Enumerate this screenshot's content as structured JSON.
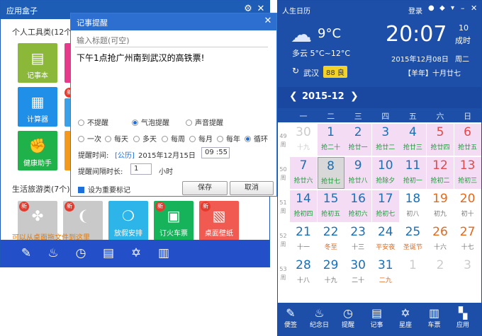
{
  "app_box": {
    "title": "应用盒子",
    "section_tools": "个人工具类(12个",
    "section_life": "生活旅游类(7个)",
    "drag_hint": "可以从桌面拖文件到这里",
    "new_badge": "新",
    "tiles": [
      {
        "label": "记事本",
        "color": "#8cb83a",
        "icon": "▤"
      },
      {
        "label": "计算器",
        "color": "#1f8fe8",
        "icon": "▦"
      },
      {
        "label": "健康助手",
        "color": "#1fb24a",
        "icon": "✊"
      }
    ],
    "life_tiles": [
      {
        "label": "",
        "color": "#c9c9c9",
        "icon": "✤"
      },
      {
        "label": "",
        "color": "#c9c9c9",
        "icon": "❨"
      },
      {
        "label": "放假安排",
        "color": "#2db4e8",
        "icon": "❍"
      },
      {
        "label": "订火车票",
        "color": "#16b35a",
        "icon": "▣"
      },
      {
        "label": "桌面壁纸",
        "color": "#f05a50",
        "icon": "▧"
      }
    ],
    "bottom_icons": [
      "pencil-icon",
      "birthday-cake-icon",
      "alarm-clock-icon",
      "notepad-icon",
      "star-of-david-icon",
      "train-icon"
    ],
    "bottom_glyphs": [
      "✎",
      "♨",
      "◷",
      "▤",
      "✡",
      "▥"
    ],
    "controls": {
      "settings": "⚙",
      "close": "✕"
    }
  },
  "dialog": {
    "title": "记事提醒",
    "close": "✕",
    "title_placeholder": "输入标题(可空)",
    "body": "下午1点抢广州南到武汉的高铁票!",
    "notify_options": [
      "不提醒",
      "气泡提醒",
      "声音提醒"
    ],
    "notify_selected": 1,
    "repeat_options": [
      "一次",
      "每天",
      "多天",
      "每周",
      "每月",
      "每年",
      "循环"
    ],
    "repeat_selected": 6,
    "remind_time_label": "提醒时间:",
    "calendar_type": "[公历]",
    "date": "2015年12月15日",
    "time": "09 :55",
    "interval_label": "提醒间隔时长:",
    "interval_value": "1",
    "interval_unit": "小时",
    "important_label": "设为重要标记",
    "save": "保存",
    "cancel": "取消"
  },
  "calendar": {
    "app_name": "人生日历",
    "login": "登录",
    "weather_temp": "9°C",
    "weather_desc": "多云 5°C~12°C",
    "city": "武汉",
    "aqi": "88 良",
    "time": "20:07",
    "second": "10",
    "second_unit": "成时",
    "date": "2015年12月08日",
    "weekday": "周二",
    "lunar": "【羊年】十月廿七",
    "month": "2015-12",
    "week_headers": [
      "一",
      "二",
      "三",
      "四",
      "五",
      "六",
      "日"
    ],
    "week_prefix": "周",
    "colors": {
      "header": "#1d4fa8",
      "ticket": "#1c9a3a",
      "holiday": "#e06a1e",
      "weekend": "#e04a4a",
      "number": "#1a6fb5"
    },
    "weeks": [
      {
        "no": "49",
        "days": [
          {
            "d": "30",
            "l": "十九",
            "t": "dim"
          },
          {
            "d": "1",
            "l": "抢二十",
            "t": "tk"
          },
          {
            "d": "2",
            "l": "抢廿一",
            "t": "tk"
          },
          {
            "d": "3",
            "l": "抢廿二",
            "t": "tk"
          },
          {
            "d": "4",
            "l": "抢廿三",
            "t": "tk"
          },
          {
            "d": "5",
            "l": "抢廿四",
            "t": "tkw"
          },
          {
            "d": "6",
            "l": "抢廿五",
            "t": "tkw"
          }
        ]
      },
      {
        "no": "50",
        "days": [
          {
            "d": "7",
            "l": "抢廿六",
            "t": "tk"
          },
          {
            "d": "8",
            "l": "抢廿七",
            "t": "sel"
          },
          {
            "d": "9",
            "l": "抢廿八",
            "t": "tk"
          },
          {
            "d": "10",
            "l": "抢除夕",
            "t": "tk"
          },
          {
            "d": "11",
            "l": "抢初一",
            "t": "tk"
          },
          {
            "d": "12",
            "l": "抢初二",
            "t": "tkw"
          },
          {
            "d": "13",
            "l": "抢初三",
            "t": "tkw"
          }
        ]
      },
      {
        "no": "51",
        "days": [
          {
            "d": "14",
            "l": "抢初四",
            "t": "tk"
          },
          {
            "d": "15",
            "l": "抢初五",
            "t": "tk"
          },
          {
            "d": "16",
            "l": "抢初六",
            "t": "tk"
          },
          {
            "d": "17",
            "l": "抢初七",
            "t": "tk"
          },
          {
            "d": "18",
            "l": "初八",
            "t": "n"
          },
          {
            "d": "19",
            "l": "初九",
            "t": "we"
          },
          {
            "d": "20",
            "l": "初十",
            "t": "we"
          }
        ]
      },
      {
        "no": "52",
        "days": [
          {
            "d": "21",
            "l": "十一",
            "t": "n"
          },
          {
            "d": "22",
            "l": "冬至",
            "t": "hol"
          },
          {
            "d": "23",
            "l": "十三",
            "t": "n"
          },
          {
            "d": "24",
            "l": "平安夜",
            "t": "hol"
          },
          {
            "d": "25",
            "l": "圣诞节",
            "t": "hol"
          },
          {
            "d": "26",
            "l": "十六",
            "t": "we"
          },
          {
            "d": "27",
            "l": "十七",
            "t": "we"
          }
        ]
      },
      {
        "no": "53",
        "days": [
          {
            "d": "28",
            "l": "十八",
            "t": "n"
          },
          {
            "d": "29",
            "l": "十九",
            "t": "n"
          },
          {
            "d": "30",
            "l": "二十",
            "t": "n"
          },
          {
            "d": "31",
            "l": "二九",
            "t": "hol"
          },
          {
            "d": "1",
            "l": "",
            "t": "dim"
          },
          {
            "d": "2",
            "l": "",
            "t": "dim"
          },
          {
            "d": "3",
            "l": "",
            "t": "dim"
          }
        ]
      }
    ],
    "bottom": [
      {
        "label": "便签",
        "icon": "✎",
        "name": "notes-button"
      },
      {
        "label": "纪念日",
        "icon": "♨",
        "name": "anniversary-button"
      },
      {
        "label": "提醒",
        "icon": "◷",
        "name": "reminder-button"
      },
      {
        "label": "记事",
        "icon": "▤",
        "name": "memo-button"
      },
      {
        "label": "星座",
        "icon": "✡",
        "name": "horoscope-button"
      },
      {
        "label": "车票",
        "icon": "▥",
        "name": "train-ticket-button"
      },
      {
        "label": "应用",
        "icon": "▚",
        "name": "apps-button"
      }
    ]
  }
}
